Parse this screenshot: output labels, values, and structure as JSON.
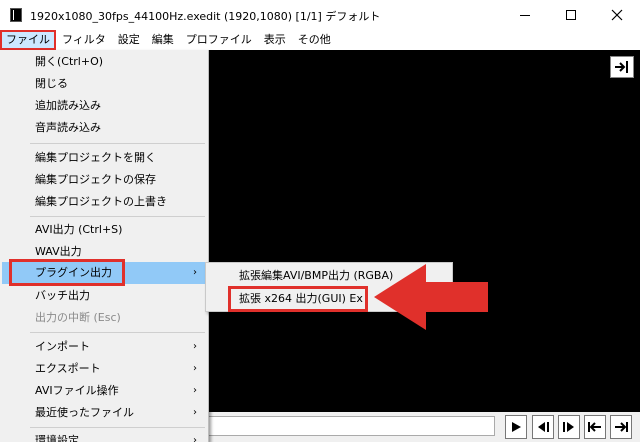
{
  "window": {
    "title": "1920x1080_30fps_44100Hz.exedit (1920,1080)  [1/1]  デフォルト"
  },
  "menubar": {
    "items": [
      "ファイル",
      "フィルタ",
      "設定",
      "編集",
      "プロファイル",
      "表示",
      "その他"
    ]
  },
  "file_menu": {
    "items": [
      {
        "label": "開く(Ctrl+O)"
      },
      {
        "label": "閉じる"
      },
      {
        "label": "追加読み込み"
      },
      {
        "label": "音声読み込み"
      },
      {
        "label": "編集プロジェクトを開く"
      },
      {
        "label": "編集プロジェクトの保存"
      },
      {
        "label": "編集プロジェクトの上書き"
      },
      {
        "label": "AVI出力 (Ctrl+S)"
      },
      {
        "label": "WAV出力"
      },
      {
        "label": "プラグイン出力"
      },
      {
        "label": "バッチ出力"
      },
      {
        "label": "出力の中断 (Esc)"
      },
      {
        "label": "インポート"
      },
      {
        "label": "エクスポート"
      },
      {
        "label": "AVIファイル操作"
      },
      {
        "label": "最近使ったファイル"
      },
      {
        "label": "環境設定"
      }
    ]
  },
  "plugin_submenu": {
    "items": [
      {
        "label": "拡張編集AVI/BMP出力 (RGBA)"
      },
      {
        "label": "拡張 x264 出力(GUI) Ex"
      }
    ]
  },
  "colors": {
    "annotation_red": "#e0302b",
    "highlight_blue": "#91c9f7",
    "canvas": "#000000"
  }
}
